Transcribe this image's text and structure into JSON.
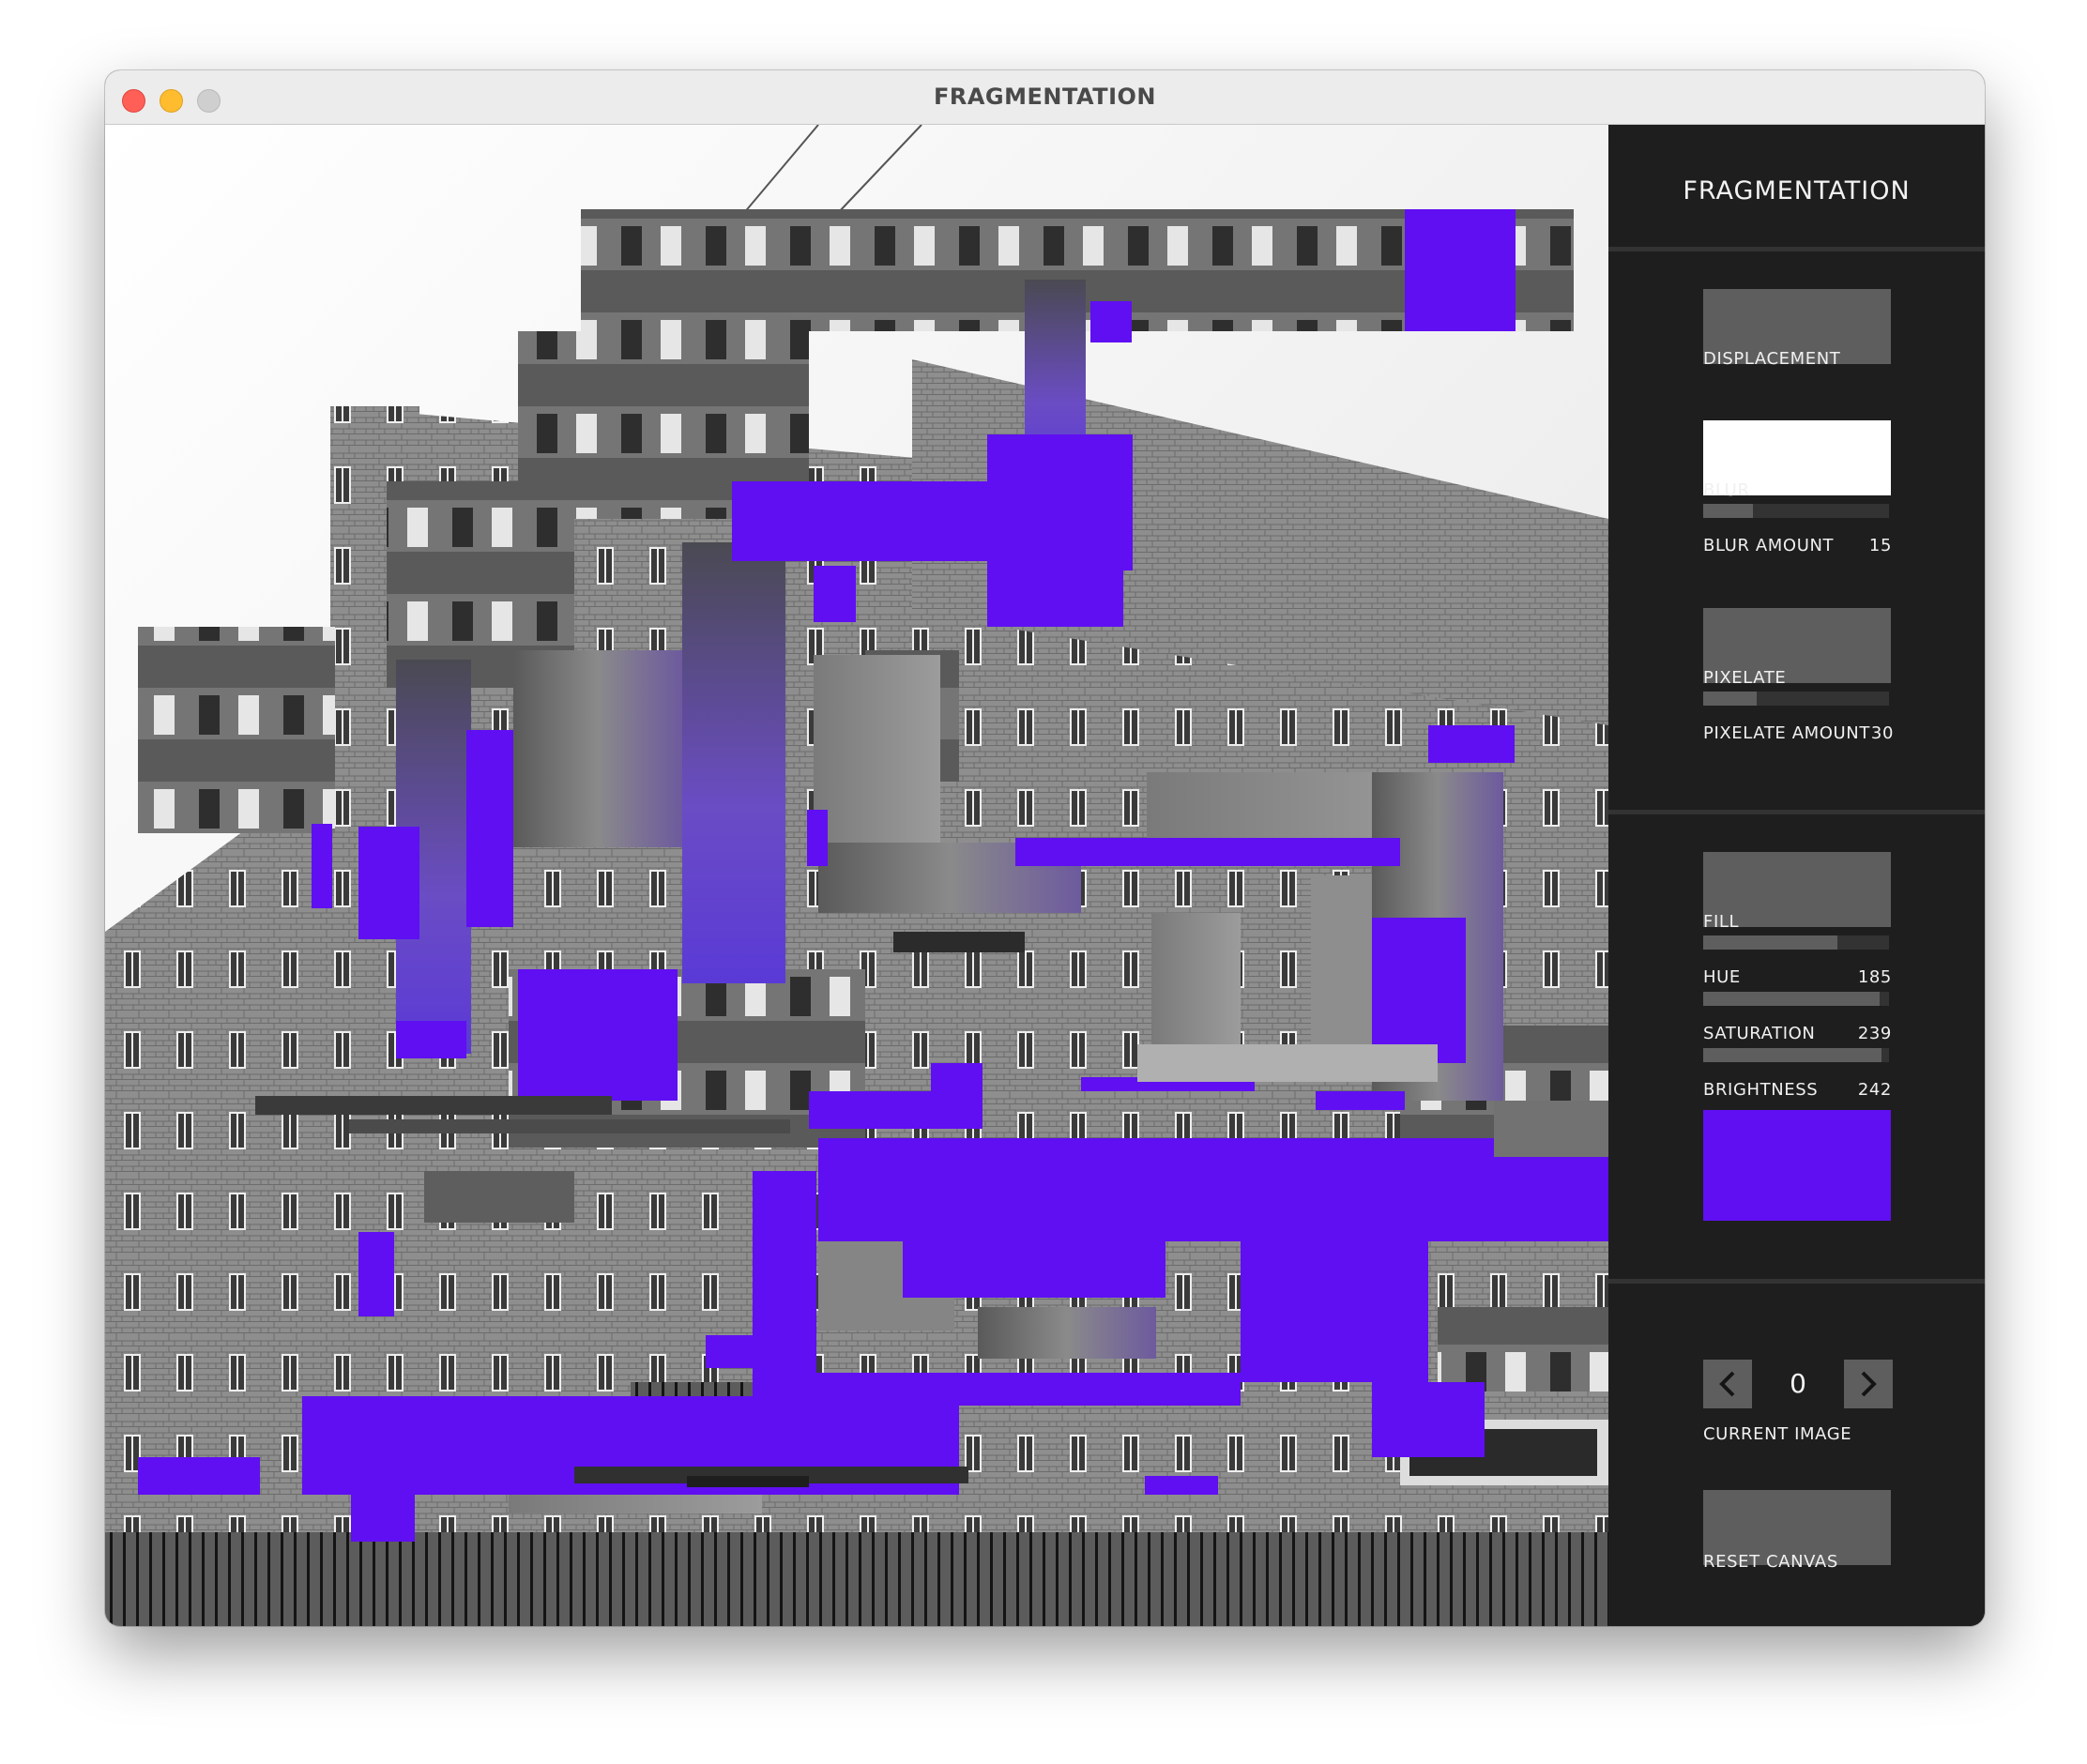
{
  "window": {
    "title": "FRAGMENTATION"
  },
  "panel": {
    "title": "FRAGMENTATION",
    "displacement": {
      "label": "DISPLACEMENT"
    },
    "blur": {
      "label": "BLUR",
      "amount_label": "BLUR AMOUNT",
      "amount_value": "15",
      "amount_fraction": 0.27
    },
    "pixelate": {
      "label": "PIXELATE",
      "amount_label": "PIXELATE AMOUNT",
      "amount_value": "30",
      "amount_fraction": 0.29
    },
    "fill": {
      "label": "FILL",
      "fraction": 0.72
    },
    "hue": {
      "label": "HUE",
      "value": "185",
      "fraction": 0.95
    },
    "saturation": {
      "label": "SATURATION",
      "value": "239",
      "fraction": 0.96
    },
    "brightness": {
      "label": "BRIGHTNESS",
      "value": "242"
    },
    "fill_color": "#5f0ff2",
    "current_image": {
      "label": "CURRENT IMAGE",
      "value": "0"
    },
    "reset": {
      "label": "RESET CANVAS"
    }
  },
  "icons": {
    "prev": "chevron-left-icon",
    "next": "chevron-right-icon"
  }
}
